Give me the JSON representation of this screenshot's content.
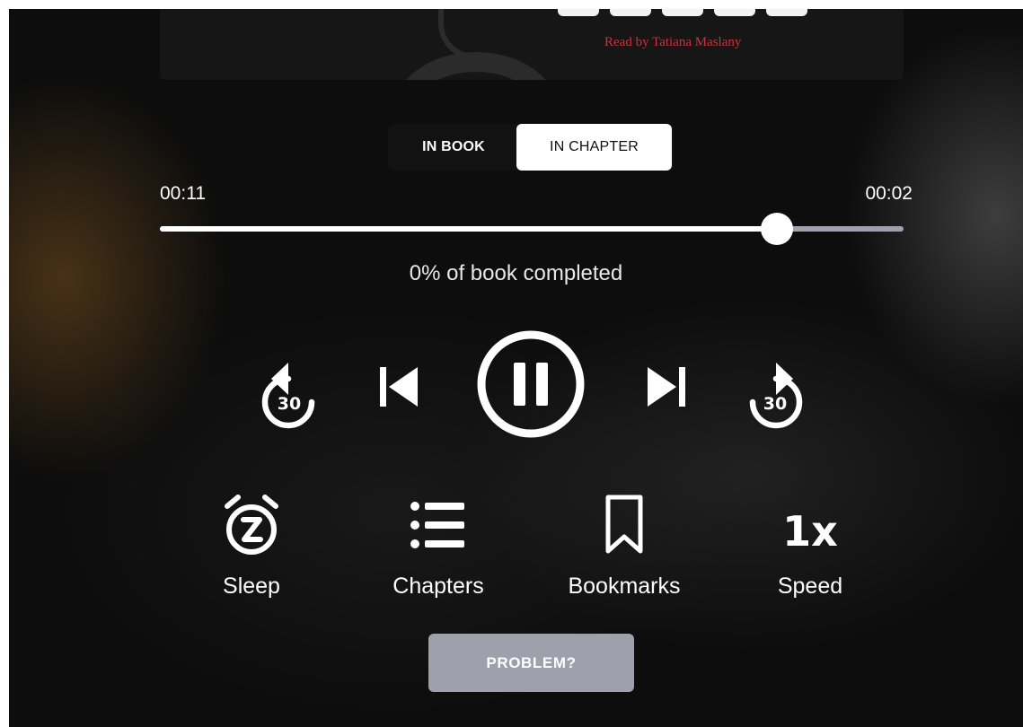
{
  "cover": {
    "narrator_text": "Read by Tatiana Maslany"
  },
  "tabs": {
    "in_book": "IN BOOK",
    "in_chapter": "IN CHAPTER",
    "selected": "IN CHAPTER"
  },
  "progress": {
    "elapsed": "00:11",
    "remaining": "00:02",
    "chapter_fraction": 0.83,
    "book_completed_text": "0% of book completed"
  },
  "controls": {
    "rewind_seconds": "30",
    "forward_seconds": "30",
    "state": "playing"
  },
  "actions": {
    "sleep_label": "Sleep",
    "chapters_label": "Chapters",
    "bookmarks_label": "Bookmarks",
    "speed_label": "Speed",
    "speed_value": "1x"
  },
  "problem_button": "PROBLEM?",
  "icons": {
    "sleep": "alarm-clock-z-icon",
    "chapters": "list-icon",
    "bookmarks": "bookmark-icon",
    "rewind": "rewind-30-icon",
    "forward": "forward-30-icon",
    "prev": "skip-previous-icon",
    "next": "skip-next-icon",
    "pause": "pause-circle-icon"
  },
  "colors": {
    "accent_white": "#ffffff",
    "track_gray": "#9ea1ab",
    "narrator_red": "#c8313e"
  }
}
